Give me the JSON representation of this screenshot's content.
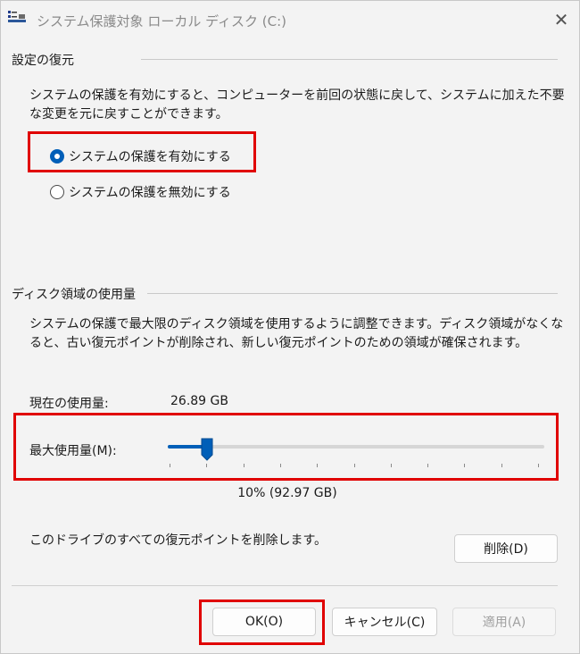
{
  "window": {
    "title": "システム保護対象 ローカル ディスク (C:)",
    "close_glyph": "✕"
  },
  "restore_settings": {
    "header": "設定の復元",
    "description_line1": "システムの保護を有効にすると、コンピューターを前回の状態に戻して、システムに加えた不要",
    "description_line2": "な変更を元に戻すことができます。",
    "options": [
      {
        "label": "システムの保護を有効にする",
        "checked": true
      },
      {
        "label": "システムの保護を無効にする",
        "checked": false
      }
    ]
  },
  "disk_usage": {
    "header": "ディスク領域の使用量",
    "description_line1": "システムの保護で最大限のディスク領域を使用するように調整できます。ディスク領域がなくな",
    "description_line2": "ると、古い復元ポイントが削除され、新しい復元ポイントのための領域が確保されます。",
    "current_usage_label": "現在の使用量:",
    "current_usage_value": "26.89 GB",
    "max_usage_label": "最大使用量(M):",
    "max_usage_fraction": 0.1,
    "max_usage_readout": "10% (92.97 GB)",
    "tick_count": 11
  },
  "delete_section": {
    "description": "このドライブのすべての復元ポイントを削除します。",
    "delete_label": "削除(D)"
  },
  "buttons": {
    "ok_label": "OK(O)",
    "cancel_label": "キャンセル(C)",
    "apply_label": "適用(A)"
  },
  "colors": {
    "accent": "#005fb8",
    "highlight_box": "#e00000"
  }
}
